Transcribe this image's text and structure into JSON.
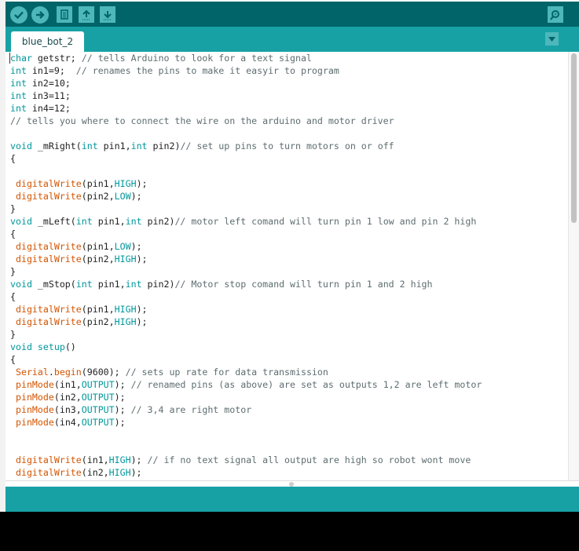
{
  "toolbar": {
    "buttons": [
      "verify",
      "upload",
      "new",
      "open",
      "save"
    ],
    "serial_monitor": "serial-monitor"
  },
  "tabs": [
    {
      "label": "blue_bot_2"
    }
  ],
  "colors": {
    "toolbar": "#006468",
    "tabbar": "#17a1a5",
    "keyword": "#00979c",
    "function": "#d35400",
    "comment": "#5e6d70"
  },
  "code": [
    [
      [
        "k",
        "char"
      ],
      [
        "p",
        " getstr; "
      ],
      [
        "c",
        "// tells Arduino to look for a text signal"
      ]
    ],
    [
      [
        "k",
        "int"
      ],
      [
        "p",
        " in1=9;  "
      ],
      [
        "c",
        "// renames the pins to make it easyir to program"
      ]
    ],
    [
      [
        "k",
        "int"
      ],
      [
        "p",
        " in2=10;"
      ]
    ],
    [
      [
        "k",
        "int"
      ],
      [
        "p",
        " in3=11;"
      ]
    ],
    [
      [
        "k",
        "int"
      ],
      [
        "p",
        " in4=12;"
      ]
    ],
    [
      [
        "c",
        "// tells you where to connect the wire on the arduino and motor driver"
      ]
    ],
    [],
    [
      [
        "k",
        "void"
      ],
      [
        "p",
        " _mRight("
      ],
      [
        "k",
        "int"
      ],
      [
        "p",
        " pin1,"
      ],
      [
        "k",
        "int"
      ],
      [
        "p",
        " pin2)"
      ],
      [
        "c",
        "// set up pins to turn motors on or off"
      ]
    ],
    [
      [
        "p",
        "{"
      ]
    ],
    [],
    [
      [
        "p",
        " "
      ],
      [
        "f",
        "digitalWrite"
      ],
      [
        "p",
        "(pin1,"
      ],
      [
        "k",
        "HIGH"
      ],
      [
        "p",
        ");"
      ]
    ],
    [
      [
        "p",
        " "
      ],
      [
        "f",
        "digitalWrite"
      ],
      [
        "p",
        "(pin2,"
      ],
      [
        "k",
        "LOW"
      ],
      [
        "p",
        ");"
      ]
    ],
    [
      [
        "p",
        "}"
      ]
    ],
    [
      [
        "k",
        "void"
      ],
      [
        "p",
        " _mLeft("
      ],
      [
        "k",
        "int"
      ],
      [
        "p",
        " pin1,"
      ],
      [
        "k",
        "int"
      ],
      [
        "p",
        " pin2)"
      ],
      [
        "c",
        "// motor left comand will turn pin 1 low and pin 2 high"
      ]
    ],
    [
      [
        "p",
        "{"
      ]
    ],
    [
      [
        "p",
        " "
      ],
      [
        "f",
        "digitalWrite"
      ],
      [
        "p",
        "(pin1,"
      ],
      [
        "k",
        "LOW"
      ],
      [
        "p",
        ");"
      ]
    ],
    [
      [
        "p",
        " "
      ],
      [
        "f",
        "digitalWrite"
      ],
      [
        "p",
        "(pin2,"
      ],
      [
        "k",
        "HIGH"
      ],
      [
        "p",
        ");"
      ]
    ],
    [
      [
        "p",
        "}"
      ]
    ],
    [
      [
        "k",
        "void"
      ],
      [
        "p",
        " _mStop("
      ],
      [
        "k",
        "int"
      ],
      [
        "p",
        " pin1,"
      ],
      [
        "k",
        "int"
      ],
      [
        "p",
        " pin2)"
      ],
      [
        "c",
        "// Motor stop comand will turn pin 1 and 2 high"
      ]
    ],
    [
      [
        "p",
        "{"
      ]
    ],
    [
      [
        "p",
        " "
      ],
      [
        "f",
        "digitalWrite"
      ],
      [
        "p",
        "(pin1,"
      ],
      [
        "k",
        "HIGH"
      ],
      [
        "p",
        ");"
      ]
    ],
    [
      [
        "p",
        " "
      ],
      [
        "f",
        "digitalWrite"
      ],
      [
        "p",
        "(pin2,"
      ],
      [
        "k",
        "HIGH"
      ],
      [
        "p",
        ");"
      ]
    ],
    [
      [
        "p",
        "}"
      ]
    ],
    [
      [
        "k",
        "void"
      ],
      [
        "p",
        " "
      ],
      [
        "k",
        "setup"
      ],
      [
        "p",
        "()"
      ]
    ],
    [
      [
        "p",
        "{"
      ]
    ],
    [
      [
        "p",
        " "
      ],
      [
        "f",
        "Serial"
      ],
      [
        "p",
        "."
      ],
      [
        "f",
        "begin"
      ],
      [
        "p",
        "(9600); "
      ],
      [
        "c",
        "// sets up rate for data transmission"
      ]
    ],
    [
      [
        "p",
        " "
      ],
      [
        "f",
        "pinMode"
      ],
      [
        "p",
        "(in1,"
      ],
      [
        "k",
        "OUTPUT"
      ],
      [
        "p",
        "); "
      ],
      [
        "c",
        "// renamed pins (as above) are set as outputs 1,2 are left motor"
      ]
    ],
    [
      [
        "p",
        " "
      ],
      [
        "f",
        "pinMode"
      ],
      [
        "p",
        "(in2,"
      ],
      [
        "k",
        "OUTPUT"
      ],
      [
        "p",
        ");"
      ]
    ],
    [
      [
        "p",
        " "
      ],
      [
        "f",
        "pinMode"
      ],
      [
        "p",
        "(in3,"
      ],
      [
        "k",
        "OUTPUT"
      ],
      [
        "p",
        "); "
      ],
      [
        "c",
        "// 3,4 are right motor"
      ]
    ],
    [
      [
        "p",
        " "
      ],
      [
        "f",
        "pinMode"
      ],
      [
        "p",
        "(in4,"
      ],
      [
        "k",
        "OUTPUT"
      ],
      [
        "p",
        ");"
      ]
    ],
    [],
    [],
    [
      [
        "p",
        " "
      ],
      [
        "f",
        "digitalWrite"
      ],
      [
        "p",
        "(in1,"
      ],
      [
        "k",
        "HIGH"
      ],
      [
        "p",
        "); "
      ],
      [
        "c",
        "// if no text signal all output are high so robot wont move"
      ]
    ],
    [
      [
        "p",
        " "
      ],
      [
        "f",
        "digitalWrite"
      ],
      [
        "p",
        "(in2,"
      ],
      [
        "k",
        "HIGH"
      ],
      [
        "p",
        ");"
      ]
    ]
  ]
}
